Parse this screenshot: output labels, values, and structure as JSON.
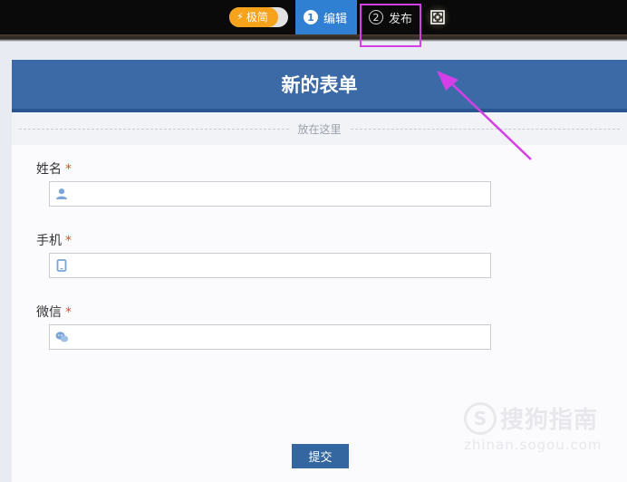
{
  "toolbar": {
    "mode_toggle": {
      "label": "极简",
      "icon": "lightning-icon",
      "accent": "#f6a21b"
    },
    "steps": [
      {
        "number": "1",
        "label": "编辑",
        "active": true,
        "accent": "#2f7fd3"
      },
      {
        "number": "2",
        "label": "发布",
        "active": false
      }
    ],
    "fullscreen": {
      "icon": "fullscreen-icon"
    }
  },
  "form": {
    "title": "新的表单",
    "header_color": "#3c6aa6",
    "drop_zone_label": "放在这里",
    "fields": [
      {
        "label": "姓名",
        "required_mark": "*",
        "icon": "user-icon",
        "value": ""
      },
      {
        "label": "手机",
        "required_mark": "*",
        "icon": "phone-icon",
        "value": ""
      },
      {
        "label": "微信",
        "required_mark": "*",
        "icon": "wechat-icon",
        "value": ""
      }
    ],
    "submit_label": "提交"
  },
  "annotation": {
    "highlight_color": "#d43fe8"
  },
  "watermark": {
    "logo_glyph": "S",
    "name": "搜狗指南",
    "url": "zhinan.sogou.com"
  }
}
